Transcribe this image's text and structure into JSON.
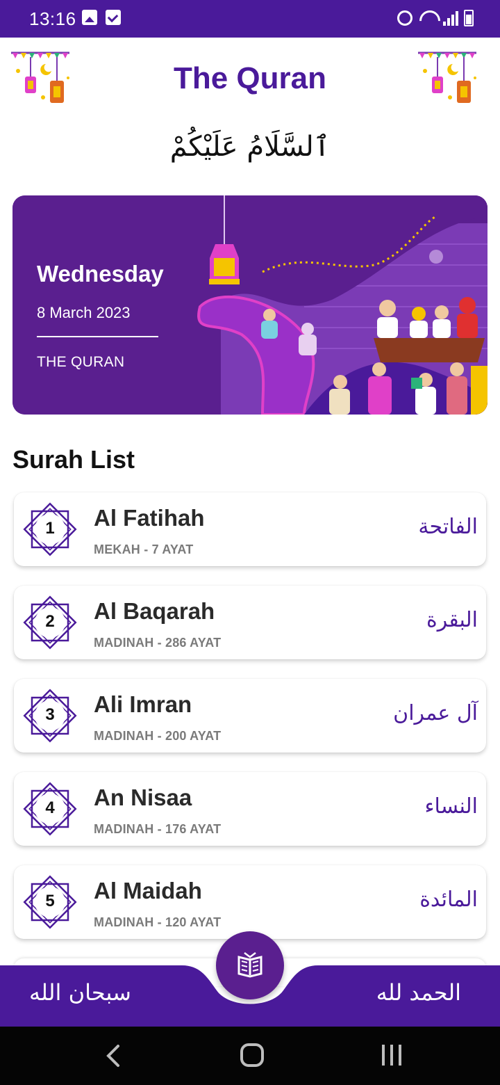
{
  "status_bar": {
    "time": "13:16",
    "icons": [
      "image-icon",
      "checkbox-icon",
      "alarm-icon",
      "wifi-icon",
      "signal-icon",
      "battery-icon"
    ]
  },
  "header": {
    "title": "The Quran",
    "greeting": "ٱلسَّلَامُ عَلَيْكُمْ",
    "decoration_icon": "lantern-icon"
  },
  "hero": {
    "day": "Wednesday",
    "date": "8 March 2023",
    "subtitle": "THE QURAN"
  },
  "surah_section": {
    "title": "Surah List",
    "items": [
      {
        "number": "1",
        "name": "Al Fatihah",
        "meta": "MEKAH - 7 AYAT",
        "arabic": "الفاتحة"
      },
      {
        "number": "2",
        "name": "Al Baqarah",
        "meta": "MADINAH - 286 AYAT",
        "arabic": "البقرة"
      },
      {
        "number": "3",
        "name": "Ali Imran",
        "meta": "MADINAH - 200 AYAT",
        "arabic": "آل عمران"
      },
      {
        "number": "4",
        "name": "An Nisaa",
        "meta": "MADINAH - 176 AYAT",
        "arabic": "النساء"
      },
      {
        "number": "5",
        "name": "Al Maidah",
        "meta": "MADINAH - 120 AYAT",
        "arabic": "المائدة"
      }
    ]
  },
  "bottom_nav": {
    "left_label": "سبحان الله",
    "right_label": "الحمد لله",
    "center_icon": "quran-book-icon"
  },
  "colors": {
    "primary": "#4a1a9a",
    "card_purple": "#5a1f8f",
    "accent_yellow": "#f5c400",
    "accent_pink": "#e040c8"
  }
}
